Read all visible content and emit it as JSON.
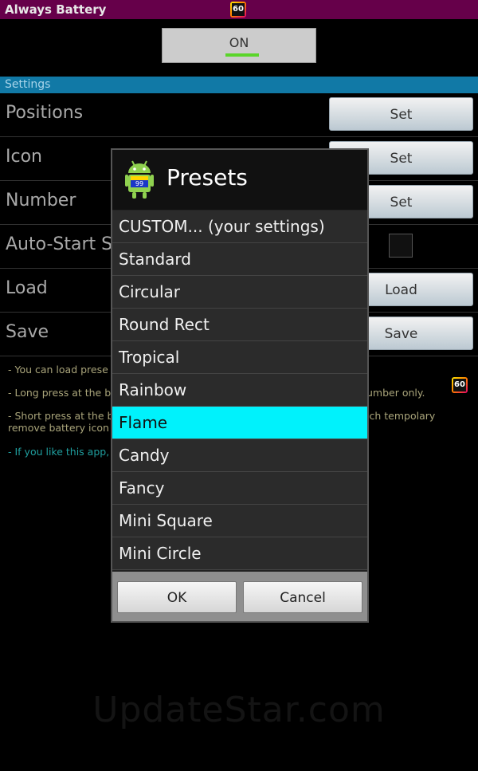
{
  "app": {
    "title": "Always Battery",
    "badge_value": "60"
  },
  "toggle": {
    "label": "ON"
  },
  "settings": {
    "header": "Settings",
    "rows": [
      {
        "label": "Positions",
        "button": "Set"
      },
      {
        "label": "Icon",
        "button": "Set"
      },
      {
        "label": "Number",
        "button": "Set"
      },
      {
        "label": "Auto-Start Se",
        "checkbox": false
      },
      {
        "label": "Load",
        "button": "Load"
      },
      {
        "label": "Save",
        "button": "Save"
      }
    ]
  },
  "help": [
    "- You can load prese",
    "- Long press at the ba",
    "umber only.",
    "- Short press at the b",
    "ich tempolary",
    "remove battery icon f",
    "- If you like this app, "
  ],
  "help_badge_value": "60",
  "watermark": "UpdateStar.com",
  "dialog": {
    "title": "Presets",
    "icon_number": "99",
    "items": [
      "CUSTOM... (your settings)",
      "Standard",
      "Circular",
      "Round Rect",
      "Tropical",
      "Rainbow",
      "Flame",
      "Candy",
      "Fancy",
      "Mini Square",
      "Mini Circle"
    ],
    "selected": "Flame",
    "ok": "OK",
    "cancel": "Cancel"
  },
  "colors": {
    "title_bar": "#66004a",
    "section_header": "#1179a6",
    "selected_item": "#00f2fc",
    "toggle_indicator": "#5ad52a"
  }
}
